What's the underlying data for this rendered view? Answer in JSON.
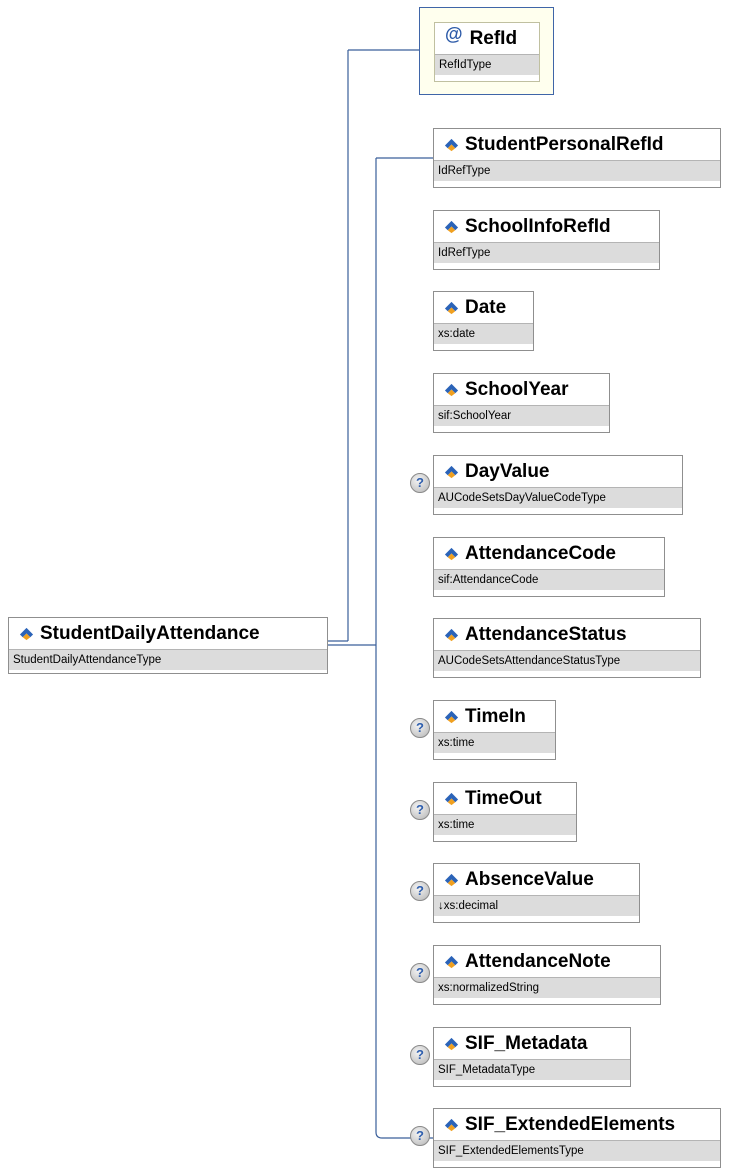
{
  "root": {
    "name": "StudentDailyAttendance",
    "type": "StudentDailyAttendanceType"
  },
  "attribute": {
    "symbol": "@",
    "name": "RefId",
    "type": "RefIdType"
  },
  "elements": [
    {
      "name": "StudentPersonalRefId",
      "type": "IdRefType",
      "optional": false
    },
    {
      "name": "SchoolInfoRefId",
      "type": "IdRefType",
      "optional": false
    },
    {
      "name": "Date",
      "type": "xs:date",
      "optional": false
    },
    {
      "name": "SchoolYear",
      "type": "sif:SchoolYear",
      "optional": false
    },
    {
      "name": "DayValue",
      "type": "AUCodeSetsDayValueCodeType",
      "optional": true
    },
    {
      "name": "AttendanceCode",
      "type": "sif:AttendanceCode",
      "optional": false
    },
    {
      "name": "AttendanceStatus",
      "type": "AUCodeSetsAttendanceStatusType",
      "optional": false
    },
    {
      "name": "TimeIn",
      "type": "xs:time",
      "optional": true
    },
    {
      "name": "TimeOut",
      "type": "xs:time",
      "optional": true
    },
    {
      "name": "AbsenceValue",
      "type": "↓xs:decimal",
      "optional": true
    },
    {
      "name": "AttendanceNote",
      "type": "xs:normalizedString",
      "optional": true
    },
    {
      "name": "SIF_Metadata",
      "type": "SIF_MetadataType",
      "optional": true
    },
    {
      "name": "SIF_ExtendedElements",
      "type": "SIF_ExtendedElementsType",
      "optional": true
    }
  ],
  "optional_marker": "?",
  "colors": {
    "connector": "#3a5f9a",
    "type_band": "#dcdcdc",
    "attribute_frame": "#3f65a8",
    "attribute_fill": "#ffffee",
    "optional_glyph": "#2f5fae"
  }
}
